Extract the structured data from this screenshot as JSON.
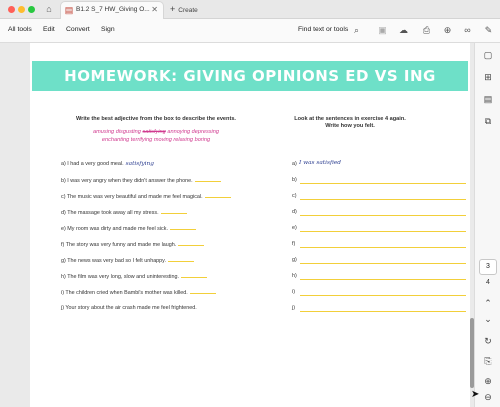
{
  "tab": {
    "title": "B1.2 S_7 HW_Giving O...",
    "new_tab": "Create"
  },
  "toolbar": {
    "menu": [
      "All tools",
      "Edit",
      "Convert",
      "Sign"
    ],
    "find": "Find text or tools"
  },
  "document": {
    "title": "HOMEWORK: GIVING OPINIONS ED VS ING",
    "instruction_left": "Write the best adjective from the box to describe the events.",
    "instruction_right_1": "Look at the sentences in exercise 4 again.",
    "instruction_right_2": "Write how you felt.",
    "adjectives_row1": [
      "amusing",
      "disgusting",
      "satisfying",
      "annoying",
      "depressing"
    ],
    "adjectives_row2": [
      "enchanting",
      "terrifying",
      "moving",
      "relaxing",
      "boring"
    ],
    "questions": [
      "a) I had a very good meal.",
      "b) I was very angry when they didn't answer the phone.",
      "c) The music was very beautiful and made me feel magical.",
      "d) The massage took away all my stress.",
      "e) My room was dirty and made me feel sick.",
      "f) The story was very funny and made me laugh.",
      "g) The news was very bad so I felt unhappy.",
      "h) The film was very long, slow and uninteresting.",
      "i) The children cried when Bambi's mother was killed.",
      "j) Your story about the air crash made me feel frightened."
    ],
    "answer_a": "satisfying",
    "answer_labels": [
      "a)",
      "b)",
      "c)",
      "d)",
      "e)",
      "f)",
      "g)",
      "h)",
      "i)",
      "j)"
    ],
    "answer_right_a": "I was satisfied"
  },
  "rail": {
    "current_page": "3",
    "total_pages": "4"
  }
}
